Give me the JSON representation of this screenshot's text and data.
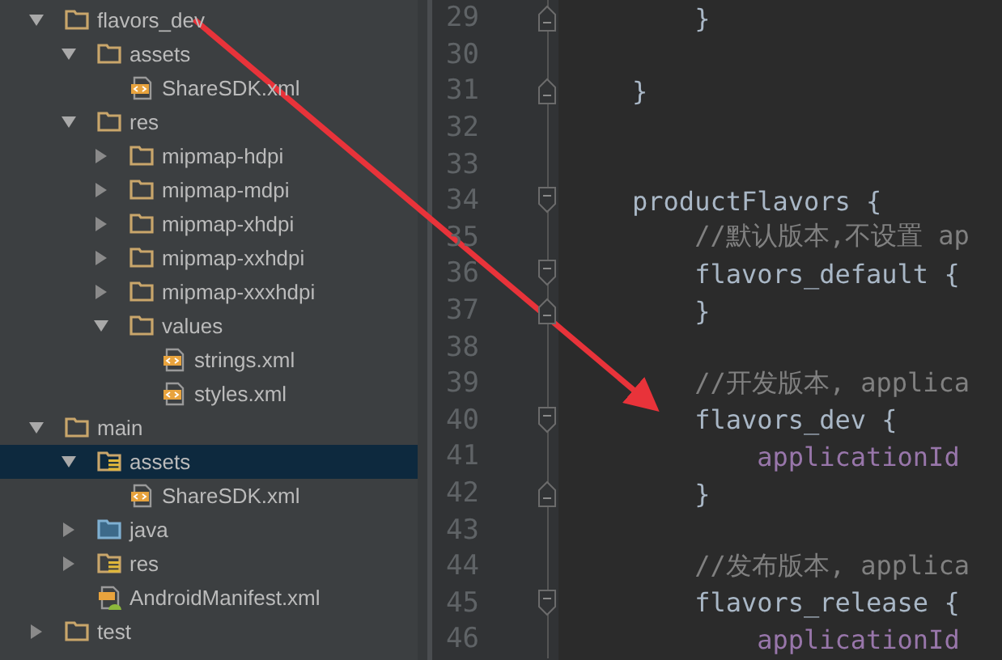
{
  "project_tree": [
    {
      "label": "flavors_dev",
      "kind": "folder",
      "expanded": true,
      "selected": false,
      "children": [
        {
          "label": "assets",
          "kind": "folder",
          "expanded": true,
          "selected": false,
          "children": [
            {
              "label": "ShareSDK.xml",
              "kind": "xml",
              "selected": false
            }
          ]
        },
        {
          "label": "res",
          "kind": "folder",
          "expanded": true,
          "selected": false,
          "children": [
            {
              "label": "mipmap-hdpi",
              "kind": "folder",
              "expanded": false,
              "selected": false
            },
            {
              "label": "mipmap-mdpi",
              "kind": "folder",
              "expanded": false,
              "selected": false
            },
            {
              "label": "mipmap-xhdpi",
              "kind": "folder",
              "expanded": false,
              "selected": false
            },
            {
              "label": "mipmap-xxhdpi",
              "kind": "folder",
              "expanded": false,
              "selected": false
            },
            {
              "label": "mipmap-xxxhdpi",
              "kind": "folder",
              "expanded": false,
              "selected": false
            },
            {
              "label": "values",
              "kind": "folder",
              "expanded": true,
              "selected": false,
              "children": [
                {
                  "label": "strings.xml",
                  "kind": "xml",
                  "selected": false
                },
                {
                  "label": "styles.xml",
                  "kind": "xml",
                  "selected": false
                }
              ]
            }
          ]
        }
      ]
    },
    {
      "label": "main",
      "kind": "folder",
      "expanded": true,
      "selected": false,
      "children": [
        {
          "label": "assets",
          "kind": "resource-folder",
          "expanded": true,
          "selected": true,
          "children": [
            {
              "label": "ShareSDK.xml",
              "kind": "xml",
              "selected": false
            }
          ]
        },
        {
          "label": "java",
          "kind": "source-folder",
          "expanded": false,
          "selected": false
        },
        {
          "label": "res",
          "kind": "resource-folder",
          "expanded": false,
          "selected": false
        },
        {
          "label": "AndroidManifest.xml",
          "kind": "manifest",
          "selected": false
        }
      ]
    },
    {
      "label": "test",
      "kind": "folder",
      "expanded": false,
      "selected": false
    }
  ],
  "editor": {
    "lines": [
      {
        "number": "29",
        "kind": "fold-end",
        "segments": [
          {
            "kind": "plain",
            "text": "        }"
          }
        ]
      },
      {
        "number": "30"
      },
      {
        "number": "31",
        "kind": "fold-end",
        "segments": [
          {
            "kind": "plain",
            "text": "    }"
          }
        ]
      },
      {
        "number": "32"
      },
      {
        "number": "33"
      },
      {
        "number": "34",
        "kind": "fold-start",
        "segments": [
          {
            "kind": "plain",
            "text": "    productFlavors {"
          }
        ]
      },
      {
        "number": "35",
        "segments": [
          {
            "kind": "comment",
            "text": "        //默认版本,不设置 ap"
          }
        ]
      },
      {
        "number": "36",
        "kind": "fold-start",
        "segments": [
          {
            "kind": "plain",
            "text": "        flavors_default {"
          }
        ]
      },
      {
        "number": "37",
        "kind": "fold-end",
        "segments": [
          {
            "kind": "plain",
            "text": "        }"
          }
        ]
      },
      {
        "number": "38"
      },
      {
        "number": "39",
        "segments": [
          {
            "kind": "comment",
            "text": "        //开发版本, applica"
          }
        ]
      },
      {
        "number": "40",
        "kind": "fold-start",
        "segments": [
          {
            "kind": "plain",
            "text": "        flavors_dev {"
          }
        ]
      },
      {
        "number": "41",
        "segments": [
          {
            "kind": "property",
            "text": "            applicationId"
          }
        ]
      },
      {
        "number": "42",
        "kind": "fold-end",
        "segments": [
          {
            "kind": "plain",
            "text": "        }"
          }
        ]
      },
      {
        "number": "43"
      },
      {
        "number": "44",
        "segments": [
          {
            "kind": "comment",
            "text": "        //发布版本, applica"
          }
        ]
      },
      {
        "number": "45",
        "kind": "fold-start",
        "segments": [
          {
            "kind": "plain",
            "text": "        flavors_release {"
          }
        ]
      },
      {
        "number": "46",
        "segments": [
          {
            "kind": "property",
            "text": "            applicationId"
          }
        ]
      }
    ]
  }
}
